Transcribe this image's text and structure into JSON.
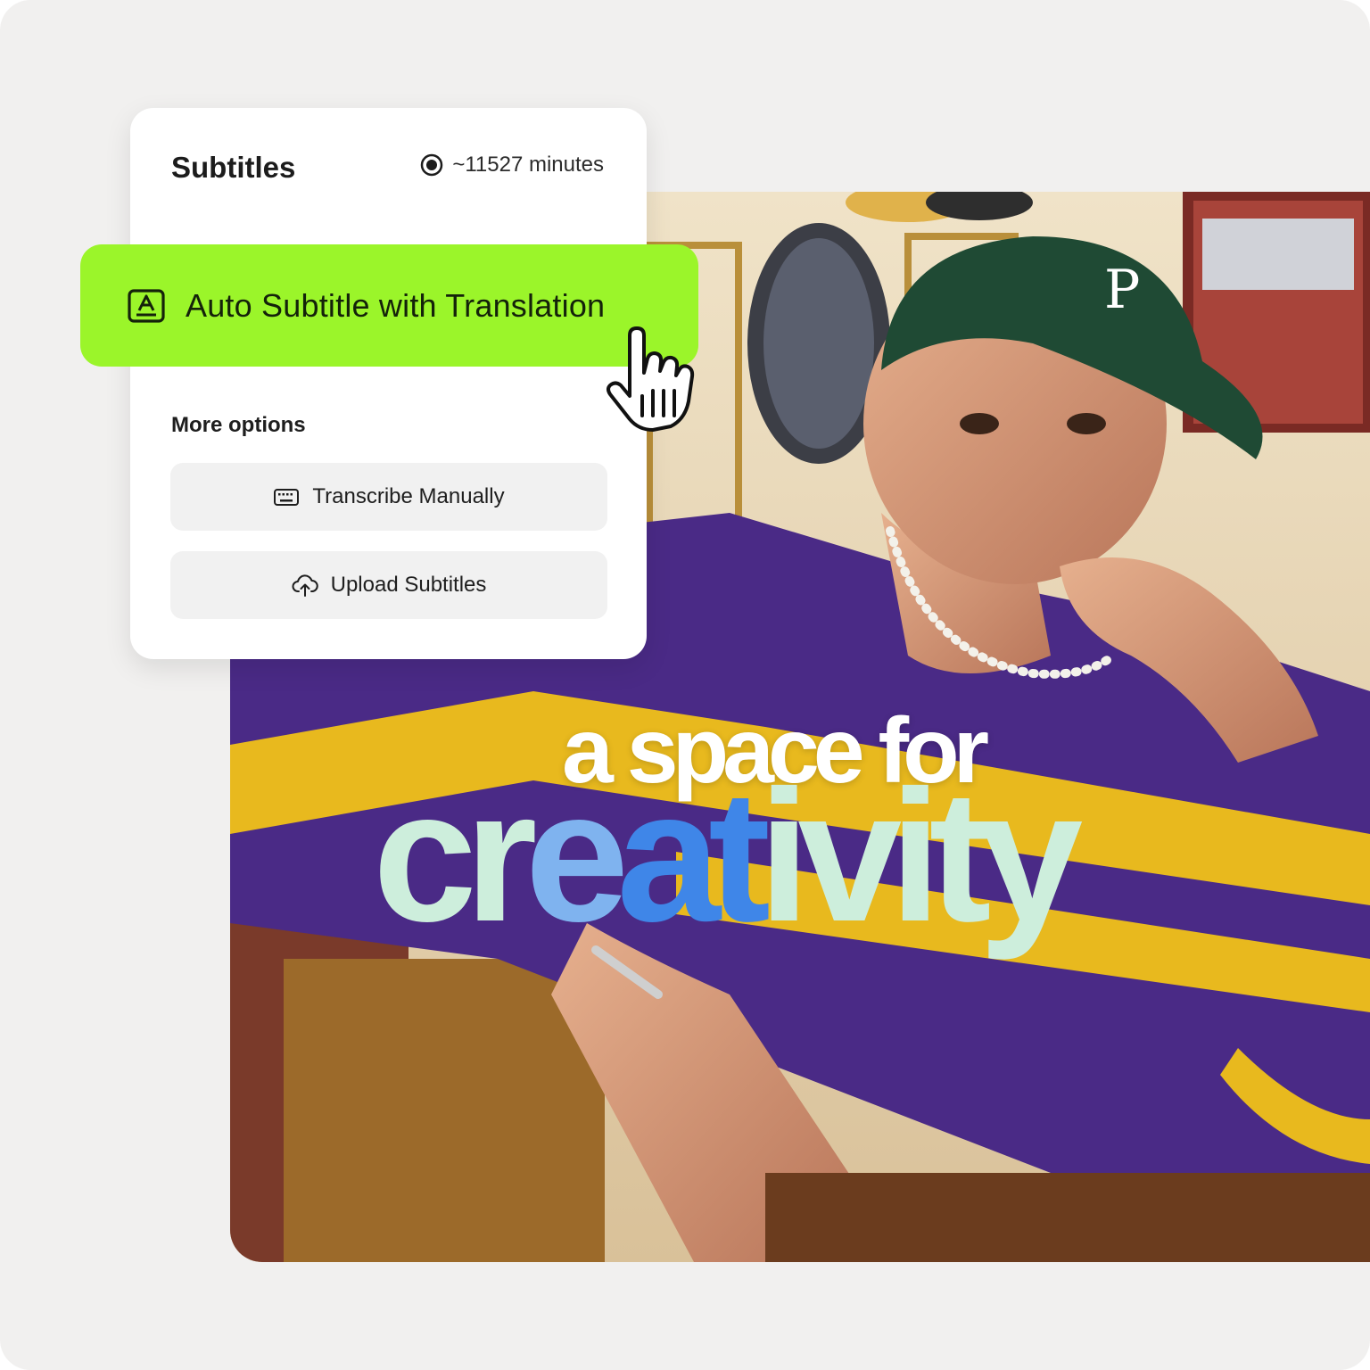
{
  "panel": {
    "title": "Subtitles",
    "minutes": "~11527 minutes",
    "primary_button": {
      "label": "Auto Subtitle with Translation",
      "icon": "auto-subtitle-icon"
    },
    "more_options_label": "More options",
    "options": [
      {
        "label": "Transcribe Manually",
        "icon": "keyboard-icon"
      },
      {
        "label": "Upload Subtitles",
        "icon": "cloud-upload-icon"
      }
    ]
  },
  "video": {
    "caption_line1": "a space for",
    "caption_line2": [
      "cr",
      "e",
      "a",
      "t",
      "ivity"
    ]
  },
  "colors": {
    "accent_green": "#9bf52a",
    "caption_mint": "#cdeedc",
    "caption_blue": "#3f86e8"
  }
}
